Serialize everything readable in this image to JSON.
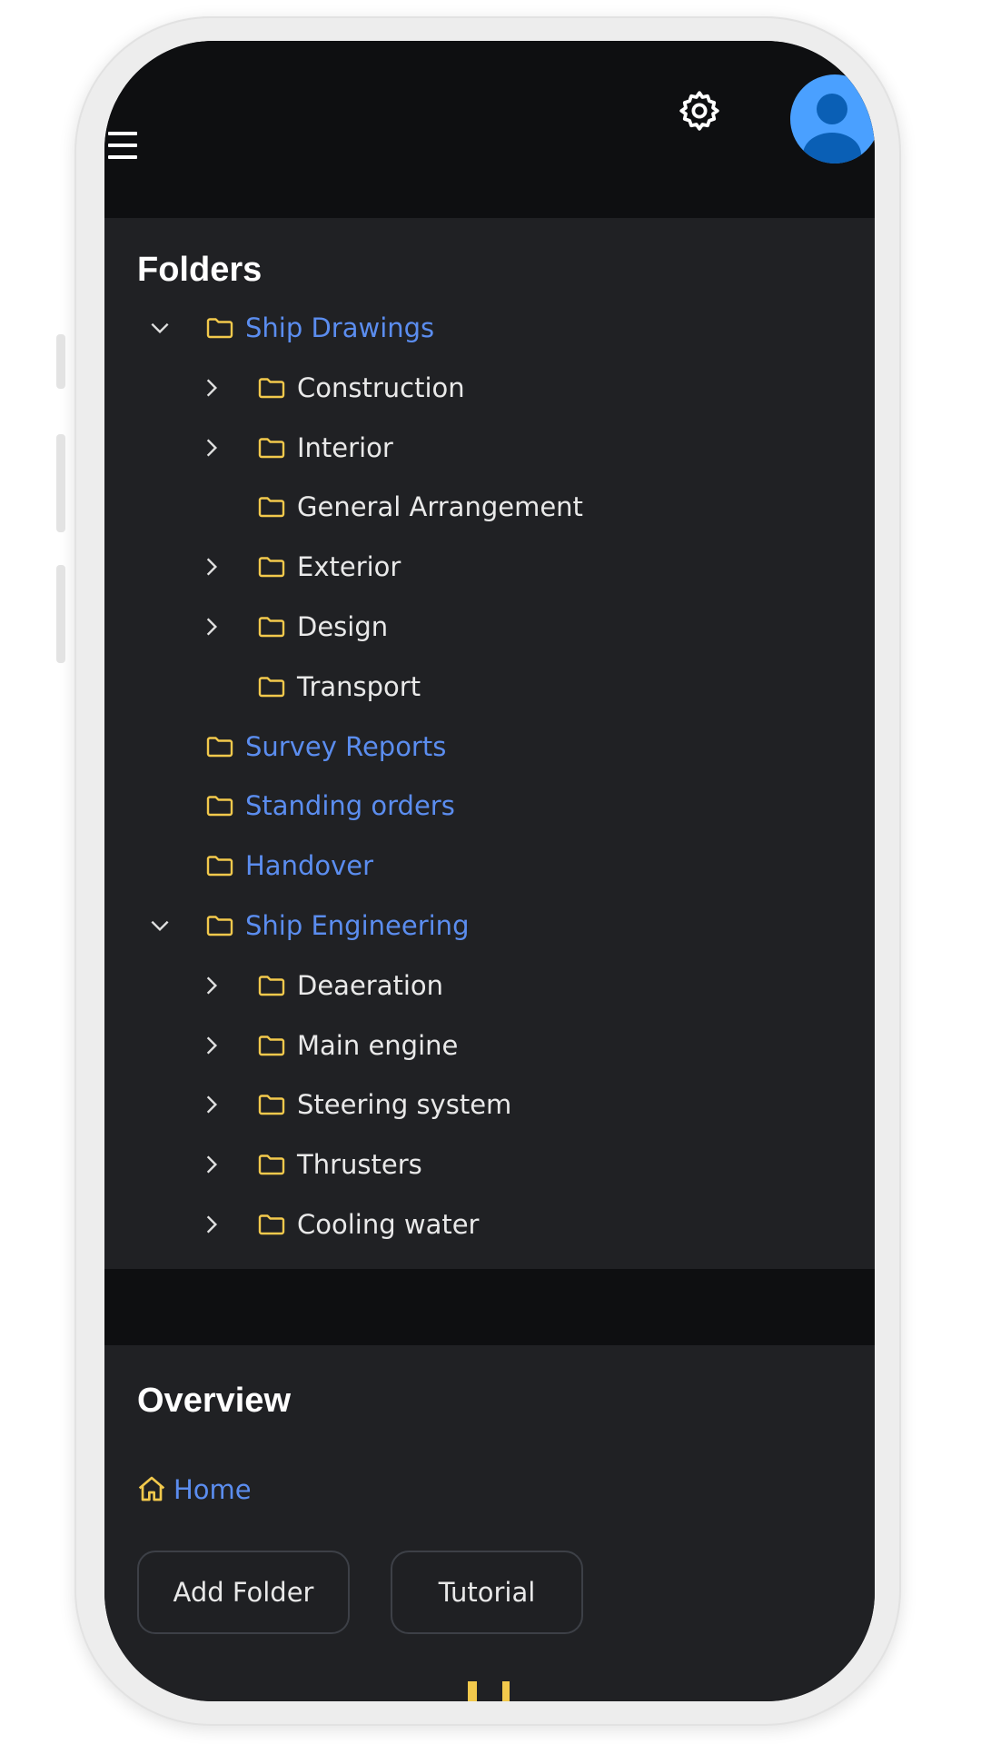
{
  "folders_panel": {
    "title": "Folders",
    "items": [
      {
        "label": "Ship Drawings",
        "level": 0,
        "expandable": true,
        "expanded": true
      },
      {
        "label": "Construction",
        "level": 1,
        "expandable": true,
        "expanded": false
      },
      {
        "label": "Interior",
        "level": 1,
        "expandable": true,
        "expanded": false
      },
      {
        "label": "General Arrangement",
        "level": 1,
        "expandable": false
      },
      {
        "label": "Exterior",
        "level": 1,
        "expandable": true,
        "expanded": false
      },
      {
        "label": "Design",
        "level": 1,
        "expandable": true,
        "expanded": false
      },
      {
        "label": "Transport",
        "level": 1,
        "expandable": false
      },
      {
        "label": "Survey Reports",
        "level": 0,
        "expandable": false
      },
      {
        "label": "Standing orders",
        "level": 0,
        "expandable": false
      },
      {
        "label": "Handover",
        "level": 0,
        "expandable": false
      },
      {
        "label": "Ship Engineering",
        "level": 0,
        "expandable": true,
        "expanded": true
      },
      {
        "label": "Deaeration",
        "level": 1,
        "expandable": true,
        "expanded": false
      },
      {
        "label": "Main engine",
        "level": 1,
        "expandable": true,
        "expanded": false
      },
      {
        "label": "Steering system",
        "level": 1,
        "expandable": true,
        "expanded": false
      },
      {
        "label": "Thrusters",
        "level": 1,
        "expandable": true,
        "expanded": false
      },
      {
        "label": "Cooling water",
        "level": 1,
        "expandable": true,
        "expanded": false
      }
    ]
  },
  "overview_panel": {
    "title": "Overview",
    "breadcrumb_home": "Home",
    "add_folder_button": "Add Folder",
    "tutorial_button": "Tutorial"
  },
  "icons": {
    "menu": "hamburger-menu-icon",
    "settings": "gear-icon",
    "profile": "user-avatar-icon",
    "folder": "folder-icon",
    "home": "home-icon"
  },
  "colors": {
    "background": "#202124",
    "header": "#0e0f11",
    "folder_icon": "#f2c94c",
    "top_level_link": "#5b8def",
    "avatar": "#4aa0ff"
  }
}
